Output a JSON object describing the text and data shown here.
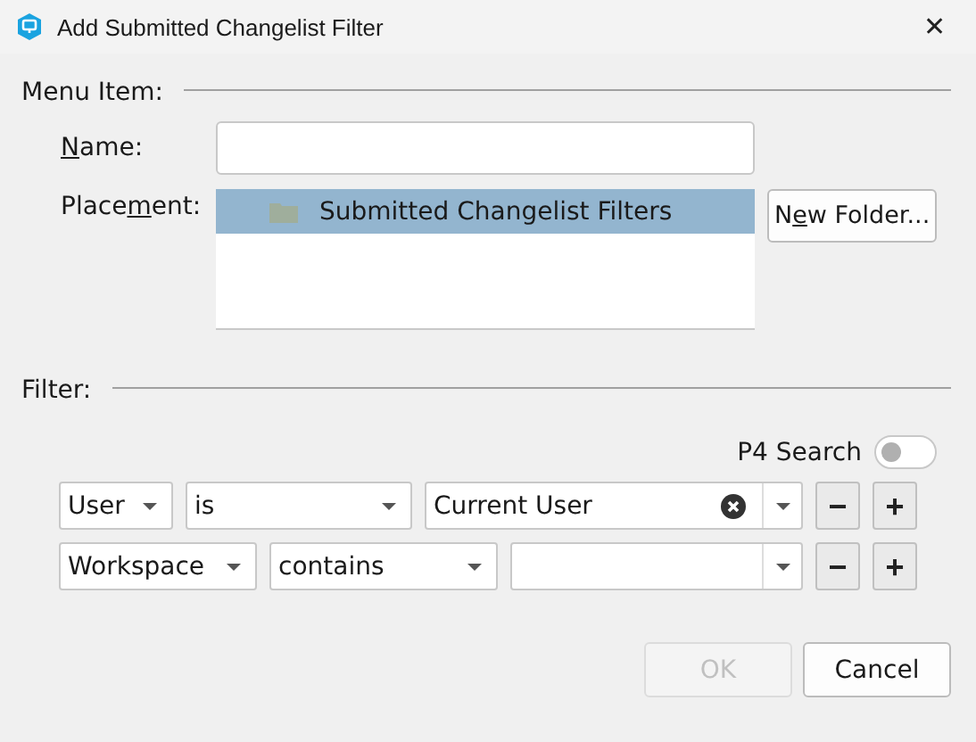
{
  "window": {
    "title": "Add Submitted Changelist Filter",
    "close": "✕"
  },
  "menu_item": {
    "heading": "Menu Item:",
    "name_label": {
      "key": "N",
      "after": "ame:"
    },
    "placement_label": [
      "Place",
      "m",
      "ent:"
    ],
    "placement_items": [
      {
        "label": "Submitted Changelist Filters",
        "selected": true
      }
    ],
    "new_folder": [
      "N",
      "e",
      "w Folder..."
    ]
  },
  "filter": {
    "heading": "Filter:",
    "p4_search": {
      "label": "P4 Search",
      "on": false
    },
    "rows": [
      {
        "field": "User",
        "operator": "is",
        "value": "Current User",
        "clearable": true
      },
      {
        "field": "Workspace",
        "operator": "contains",
        "value": "",
        "clearable": false
      }
    ],
    "remove": "−",
    "add": "+"
  },
  "buttons": [
    {
      "label": "OK",
      "disabled": true
    },
    {
      "label": "Cancel",
      "disabled": false
    }
  ]
}
